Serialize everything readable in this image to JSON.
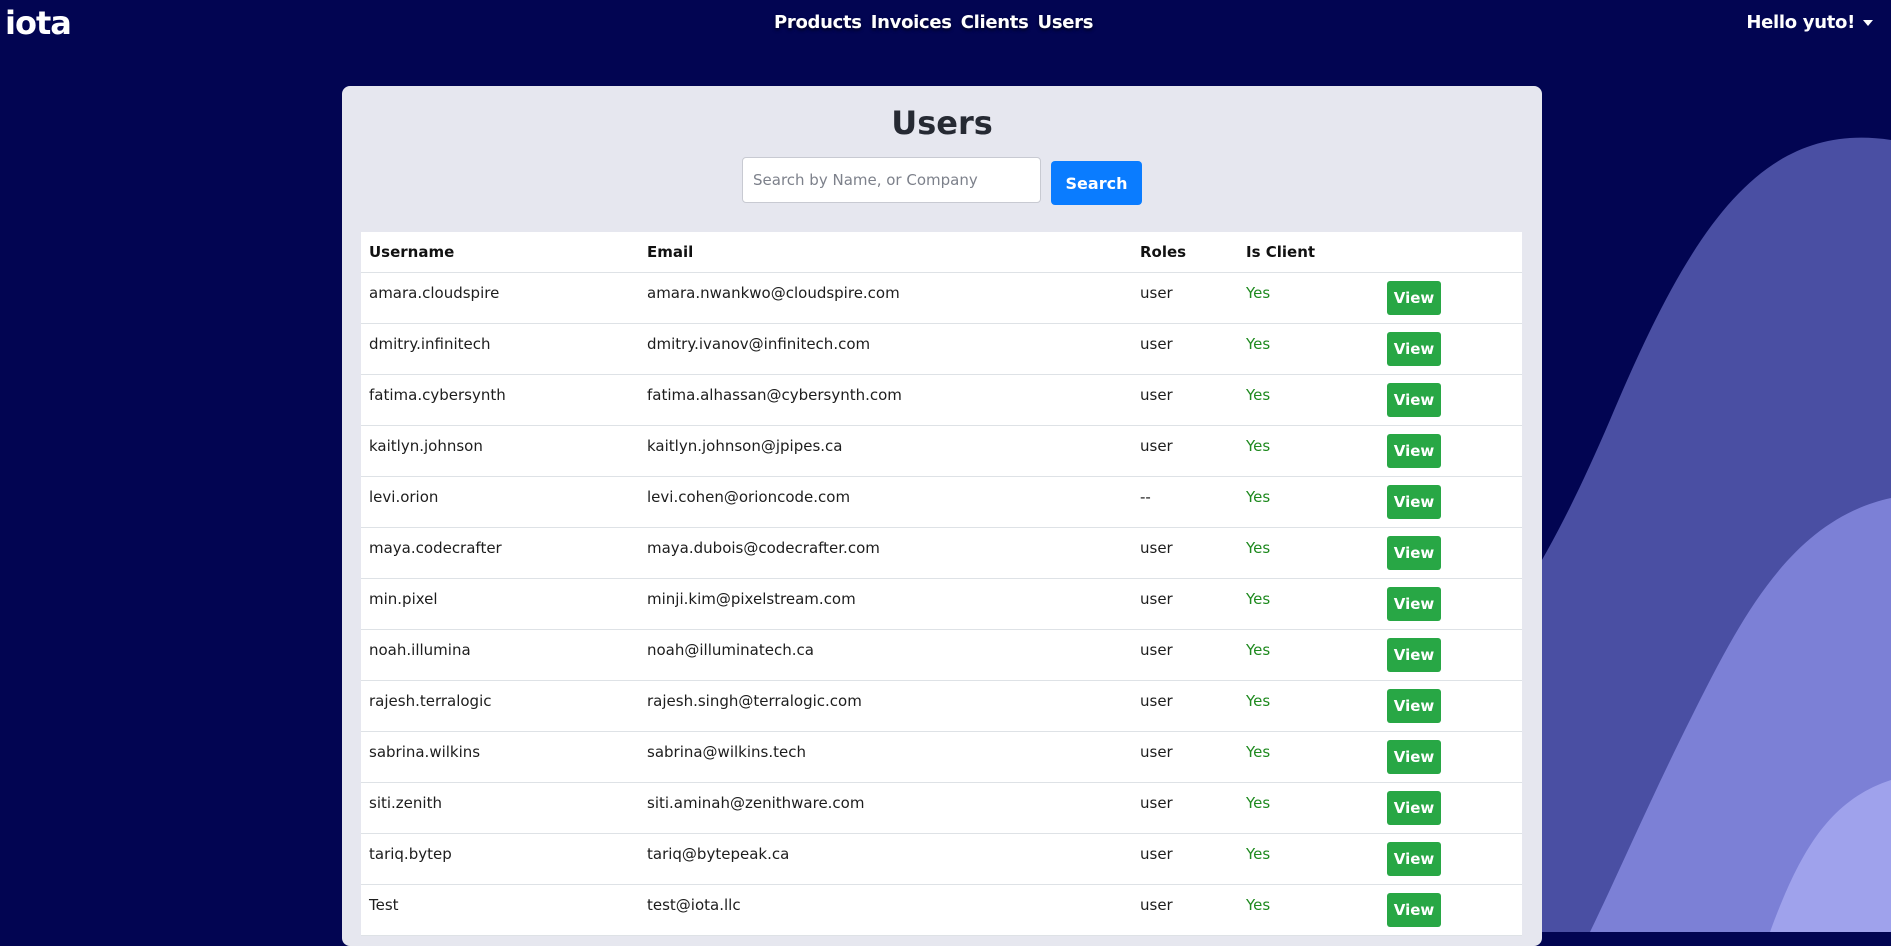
{
  "nav": {
    "logo": "iota",
    "links": [
      {
        "label": "Products"
      },
      {
        "label": "Invoices"
      },
      {
        "label": "Clients"
      },
      {
        "label": "Users"
      }
    ],
    "greeting": "Hello yuto!"
  },
  "page": {
    "title": "Users",
    "search": {
      "placeholder": "Search by Name, or Company",
      "value": "",
      "button_label": "Search"
    }
  },
  "table": {
    "headers": [
      "Username",
      "Email",
      "Roles",
      "Is Client",
      ""
    ],
    "action_label": "View",
    "rows": [
      {
        "username": "amara.cloudspire",
        "email": "amara.nwankwo@cloudspire.com",
        "roles": "user",
        "is_client": "Yes"
      },
      {
        "username": "dmitry.infinitech",
        "email": "dmitry.ivanov@infinitech.com",
        "roles": "user",
        "is_client": "Yes"
      },
      {
        "username": "fatima.cybersynth",
        "email": "fatima.alhassan@cybersynth.com",
        "roles": "user",
        "is_client": "Yes"
      },
      {
        "username": "kaitlyn.johnson",
        "email": "kaitlyn.johnson@jpipes.ca",
        "roles": "user",
        "is_client": "Yes"
      },
      {
        "username": "levi.orion",
        "email": "levi.cohen@orioncode.com",
        "roles": "--",
        "is_client": "Yes"
      },
      {
        "username": "maya.codecrafter",
        "email": "maya.dubois@codecrafter.com",
        "roles": "user",
        "is_client": "Yes"
      },
      {
        "username": "min.pixel",
        "email": "minji.kim@pixelstream.com",
        "roles": "user",
        "is_client": "Yes"
      },
      {
        "username": "noah.illumina",
        "email": "noah@illuminatech.ca",
        "roles": "user",
        "is_client": "Yes"
      },
      {
        "username": "rajesh.terralogic",
        "email": "rajesh.singh@terralogic.com",
        "roles": "user",
        "is_client": "Yes"
      },
      {
        "username": "sabrina.wilkins",
        "email": "sabrina@wilkins.tech",
        "roles": "user",
        "is_client": "Yes"
      },
      {
        "username": "siti.zenith",
        "email": "siti.aminah@zenithware.com",
        "roles": "user",
        "is_client": "Yes"
      },
      {
        "username": "tariq.bytep",
        "email": "tariq@bytepeak.ca",
        "roles": "user",
        "is_client": "Yes"
      },
      {
        "username": "Test",
        "email": "test@iota.llc",
        "roles": "user",
        "is_client": "Yes"
      }
    ]
  },
  "colors": {
    "background": "#020552",
    "wave_dark": "#4a4fa3",
    "wave_mid": "#7c80d6",
    "wave_light": "#9fa2ec",
    "primary": "#0a7cff",
    "success": "#28a745",
    "yes_text": "#1f8a1f"
  }
}
